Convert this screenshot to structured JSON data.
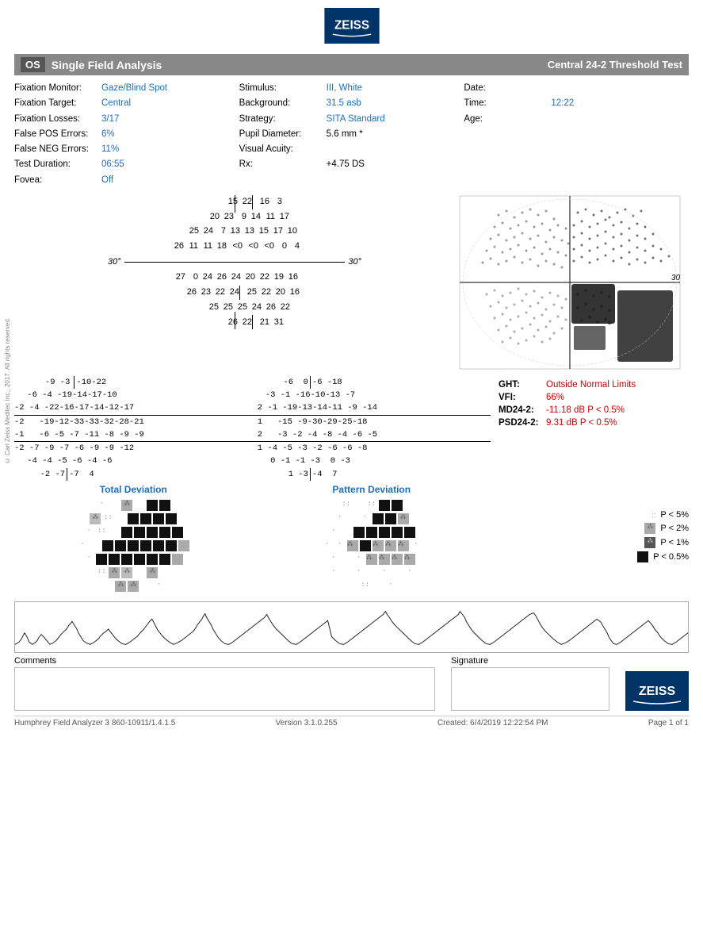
{
  "header": {
    "logo_text": "ZEISS"
  },
  "title_bar": {
    "os_label": "OS",
    "center_title": "Single Field Analysis",
    "right_title": "Central 24-2 Threshold Test"
  },
  "patient_info": {
    "fixation_monitor_label": "Fixation Monitor:",
    "fixation_monitor_value": "Gaze/Blind Spot",
    "fixation_target_label": "Fixation Target:",
    "fixation_target_value": "Central",
    "fixation_losses_label": "Fixation Losses:",
    "fixation_losses_value": "3/17",
    "false_pos_label": "False POS Errors:",
    "false_pos_value": "6%",
    "false_neg_label": "False NEG Errors:",
    "false_neg_value": "11%",
    "test_duration_label": "Test Duration:",
    "test_duration_value": "06:55",
    "fovea_label": "Fovea:",
    "fovea_value": "Off",
    "stimulus_label": "Stimulus:",
    "stimulus_value": "III, White",
    "background_label": "Background:",
    "background_value": "31.5 asb",
    "strategy_label": "Strategy:",
    "strategy_value": "SITA Standard",
    "pupil_label": "Pupil Diameter:",
    "pupil_value": "5.6 mm *",
    "visual_acuity_label": "Visual Acuity:",
    "visual_acuity_value": "",
    "rx_label": "Rx:",
    "rx_value": "+4.75 DS",
    "date_label": "Date:",
    "date_value": "",
    "time_label": "Time:",
    "time_value": "12:22",
    "age_label": "Age:",
    "age_value": ""
  },
  "threshold_grid": {
    "axis_label": "30°",
    "rows": [
      [
        " ",
        " ",
        " ",
        " ",
        "15",
        "22",
        "|",
        "16",
        "3",
        " ",
        " ",
        " ",
        " "
      ],
      [
        " ",
        " ",
        " ",
        "20",
        "23",
        "9",
        "14",
        "11",
        "17",
        " ",
        " ",
        " ",
        " "
      ],
      [
        " ",
        " ",
        "25",
        "24",
        "7",
        "13",
        "13",
        "15",
        "17",
        "10",
        " ",
        " "
      ],
      [
        " ",
        "26",
        "11",
        "11",
        "18",
        "<0",
        "<0",
        "<0",
        "0",
        "4",
        " ",
        " "
      ],
      [
        "27",
        "0",
        "24",
        "26",
        "24",
        "20",
        "22",
        "19",
        "16",
        " ",
        " "
      ],
      [
        " ",
        "26",
        "23",
        "22",
        "24",
        "|",
        "25",
        "22",
        "20",
        "16",
        " ",
        " "
      ],
      [
        " ",
        " ",
        "25",
        "25",
        "25",
        "24",
        "26",
        "22",
        " ",
        " ",
        " ",
        " "
      ],
      [
        " ",
        " ",
        " ",
        "26",
        "22",
        "|",
        "21",
        "31",
        " ",
        " ",
        " ",
        " "
      ]
    ]
  },
  "total_deviation": {
    "title": "Total Deviation",
    "rows": [
      [
        " ",
        " ",
        "-9",
        "-3",
        "|",
        "-10",
        "-22",
        " ",
        " "
      ],
      [
        " ",
        "-6",
        "-4",
        "-19",
        "-14",
        "-17",
        "-10",
        " "
      ],
      [
        "-2",
        "-4",
        "-22",
        "-16",
        "-17",
        "-14",
        "-12",
        "-17"
      ],
      [
        "-2",
        " ",
        "-19",
        "-12",
        "-33",
        "-33",
        "-32",
        "-28",
        "-21"
      ],
      [
        "-1",
        " ",
        "-6",
        "-5",
        "-7",
        "-11",
        "-8",
        "-9",
        "-9"
      ],
      [
        "-2",
        "-7",
        "-9",
        "-7",
        "-6",
        "-9",
        "-9",
        "-12"
      ],
      [
        " ",
        "-4",
        "-4",
        "-5",
        "-6",
        "-4",
        "-6",
        " "
      ],
      [
        " ",
        " ",
        "-2",
        "-7",
        "|",
        "-7",
        "4",
        " ",
        " "
      ]
    ]
  },
  "pattern_deviation": {
    "title": "Pattern Deviation",
    "rows": [
      [
        " ",
        " ",
        "-6",
        "0",
        "|",
        "-6",
        "-18",
        " ",
        " "
      ],
      [
        " ",
        "-3",
        "-1",
        "-16",
        "-10",
        "-13",
        "-7",
        " "
      ],
      [
        "2",
        "-1",
        "-19",
        "-13",
        "-14",
        "-11",
        "-9",
        "-14"
      ],
      [
        "1",
        " ",
        "-15",
        "-9",
        "-30",
        "-29",
        "-25",
        "-18"
      ],
      [
        "2",
        " ",
        "-3",
        "-2",
        "-4",
        "-8",
        "-4",
        "-6",
        "-5"
      ],
      [
        "1",
        "-4",
        "-5",
        "-3",
        "-2",
        "-6",
        "-6",
        "-8"
      ],
      [
        " ",
        "0",
        "-1",
        "-1",
        "-3",
        "0",
        "-3",
        " "
      ],
      [
        " ",
        " ",
        "1",
        "-3",
        "|",
        "-4",
        "7",
        " ",
        " "
      ]
    ]
  },
  "stats": {
    "ght_label": "GHT:",
    "ght_value": "Outside Normal Limits",
    "vfi_label": "VFI:",
    "vfi_value": "66%",
    "md_label": "MD24-2:",
    "md_value": "-11.18 dB P < 0.5%",
    "psd_label": "PSD24-2:",
    "psd_value": "9.31 dB P < 0.5%"
  },
  "legend": {
    "p5_label": "P < 5%",
    "p2_label": "P < 2%",
    "p1_label": "P < 1%",
    "p05_label": "P < 0.5%"
  },
  "bottom": {
    "comments_label": "Comments",
    "signature_label": "Signature"
  },
  "footer": {
    "left": "Humphrey Field Analyzer 3 860-10911/1.4.1.5",
    "middle": "Version 3.1.0.255",
    "right": "Created: 6/4/2019 12:22:54 PM",
    "page": "Page 1 of 1"
  },
  "copyright": "© Carl Zeiss Meditec Inc., 2017. All rights reserved."
}
